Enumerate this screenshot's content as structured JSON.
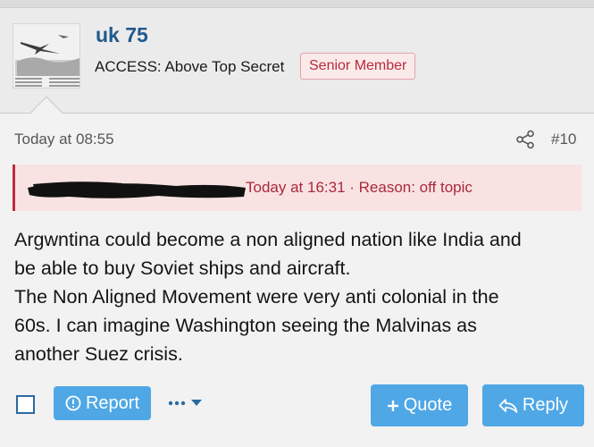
{
  "user": {
    "name": "uk 75",
    "access": "ACCESS: Above Top Secret",
    "rank": "Senior Member"
  },
  "post": {
    "date": "Today at 08:55",
    "number": "#10",
    "edit_notice": "Today at 16:31 · Reason: off topic",
    "body": [
      "Argwntina could become a non aligned nation like India and",
      "be able to buy Soviet ships and aircraft.",
      "The Non Aligned Movement were very anti colonial in the",
      "60s. I can imagine Washington seeing the Malvinas as",
      "another Suez crisis."
    ]
  },
  "actions": {
    "report_label": "Report",
    "quote_label": "Quote",
    "reply_label": "Reply"
  },
  "colors": {
    "username": "#1f5a8c",
    "badge_text": "#b52b3d",
    "badge_bg": "#fbeaea",
    "edit_bg": "#f9e2e2",
    "edit_accent": "#c12c3f",
    "button": "#4fa7e6"
  },
  "icons": {
    "share": "share-icon",
    "report": "report-alert-icon",
    "more": "more-dots-icon",
    "quote": "plus-icon",
    "reply": "reply-arrow-icon"
  }
}
